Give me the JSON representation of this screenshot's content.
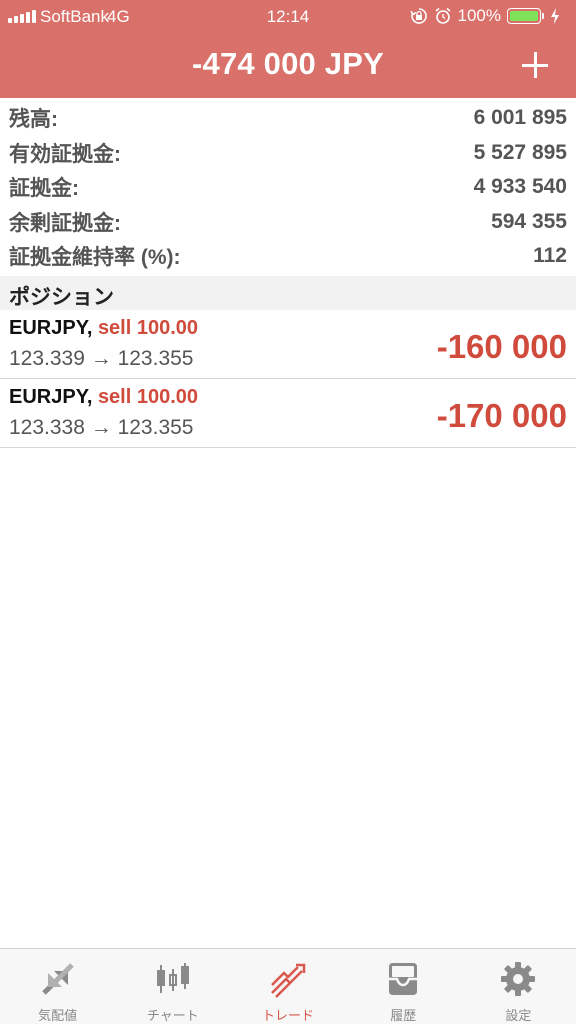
{
  "status_bar": {
    "carrier": "SoftBank",
    "network": "4G",
    "time": "12:14",
    "battery": "100%"
  },
  "header": {
    "title": "-474 000 JPY"
  },
  "summary": [
    {
      "label": "残高:",
      "value": "6 001 895"
    },
    {
      "label": "有効証拠金:",
      "value": "5 527 895"
    },
    {
      "label": "証拠金:",
      "value": "4 933 540"
    },
    {
      "label": "余剰証拠金:",
      "value": "594 355"
    },
    {
      "label": "証拠金維持率 (%):",
      "value": "112"
    }
  ],
  "section": {
    "title": "ポジション"
  },
  "positions": [
    {
      "symbol": "EURJPY,",
      "side": "sell 100.00",
      "prices": "123.339 → 123.355",
      "profit": "-160 000"
    },
    {
      "symbol": "EURJPY,",
      "side": "sell 100.00",
      "prices": "123.338 → 123.355",
      "profit": "-170 000"
    }
  ],
  "tabs": [
    {
      "label": "気配値",
      "icon": "quotes-icon",
      "active": false
    },
    {
      "label": "チャート",
      "icon": "chart-icon",
      "active": false
    },
    {
      "label": "トレード",
      "icon": "trade-icon",
      "active": true
    },
    {
      "label": "履歴",
      "icon": "history-icon",
      "active": false
    },
    {
      "label": "設定",
      "icon": "settings-icon",
      "active": false
    }
  ],
  "colors": {
    "header": "#d9706a",
    "accent": "#d9574b",
    "loss": "#d04b3c",
    "battery": "#7ee35a"
  }
}
